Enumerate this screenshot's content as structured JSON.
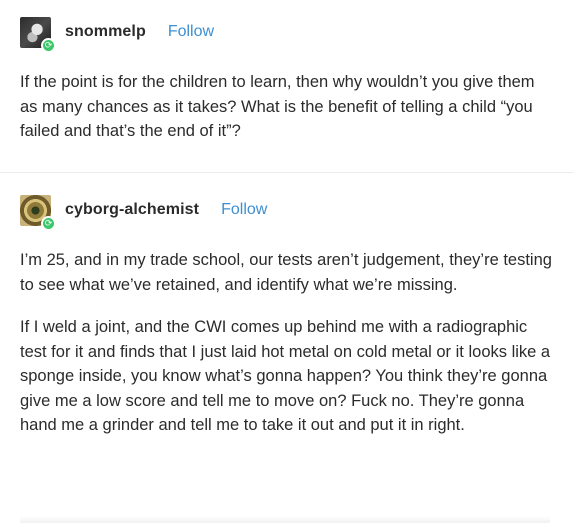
{
  "posts": [
    {
      "username": "snommelp",
      "follow_label": "Follow",
      "paragraphs": [
        "If the point is for the children to learn, then why wouldn’t you give them as many chances as it takes? What is the benefit of telling a child “you failed and that’s the end of it”?"
      ]
    },
    {
      "username": "cyborg-alchemist",
      "follow_label": "Follow",
      "paragraphs": [
        "I’m 25, and in my trade school, our tests aren’t judgement, they’re testing to see what we’ve retained, and identify what we’re missing.",
        "If I weld a joint, and the CWI comes up behind me with a radiographic test for it and finds that I just laid hot metal on cold metal or it looks like a sponge inside, you know what’s gonna happen? You think they’re gonna give me a low score and tell me to move on? Fuck no. They’re gonna hand me a grinder and tell me to take it out and put it in right."
      ]
    }
  ],
  "icons": {
    "avatar_badge": "reblog-icon",
    "colors": {
      "follow": "#3d8fd1",
      "badge": "#3cc76a",
      "text": "#2b2b2b"
    }
  }
}
